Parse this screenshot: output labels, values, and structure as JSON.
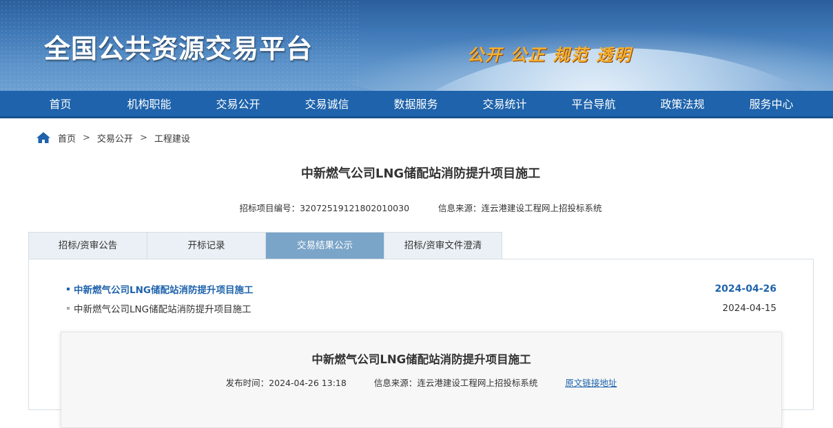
{
  "banner": {
    "site_title": "全国公共资源交易平台",
    "slogan": "公开 公正 规范 透明"
  },
  "nav": {
    "items": [
      "首页",
      "机构职能",
      "交易公开",
      "交易诚信",
      "数据服务",
      "交易统计",
      "平台导航",
      "政策法规",
      "服务中心"
    ]
  },
  "breadcrumb": {
    "items": [
      "首页",
      "交易公开",
      "工程建设"
    ],
    "separator": ">"
  },
  "project": {
    "title": "中新燃气公司LNG储配站消防提升项目施工",
    "code_label": "招标项目编号：",
    "code_value": "3207251912180201003​0",
    "source_label": "信息来源：",
    "source_value": "连云港建设工程网上招投标系统"
  },
  "tabs": {
    "items": [
      "招标/资审公告",
      "开标记录",
      "交易结果公示",
      "招标/资审文件澄清"
    ],
    "active_index": 2
  },
  "results": {
    "rows": [
      {
        "label": "中新燃气公司LNG储配站消防提升项目施工",
        "date": "2024-04-26"
      },
      {
        "label": "中新燃气公司LNG储配站消防提升项目施工",
        "date": "2024-04-15"
      }
    ]
  },
  "detail": {
    "title": "中新燃气公司LNG储配站消防提升项目施工",
    "publish_label": "发布时间：",
    "publish_value": "2024-04-26 13:18",
    "source_label": "信息来源：",
    "source_value": "连云港建设工程网上招投标系统",
    "original_link": "原文链接地址"
  },
  "colors": {
    "nav_bg": "#1e63ab",
    "tab_active_bg": "#7ba5c8",
    "link_blue": "#1e63ab",
    "slogan_gold": "#f4b030"
  },
  "icons": {
    "breadcrumb_home": "home-icon"
  }
}
